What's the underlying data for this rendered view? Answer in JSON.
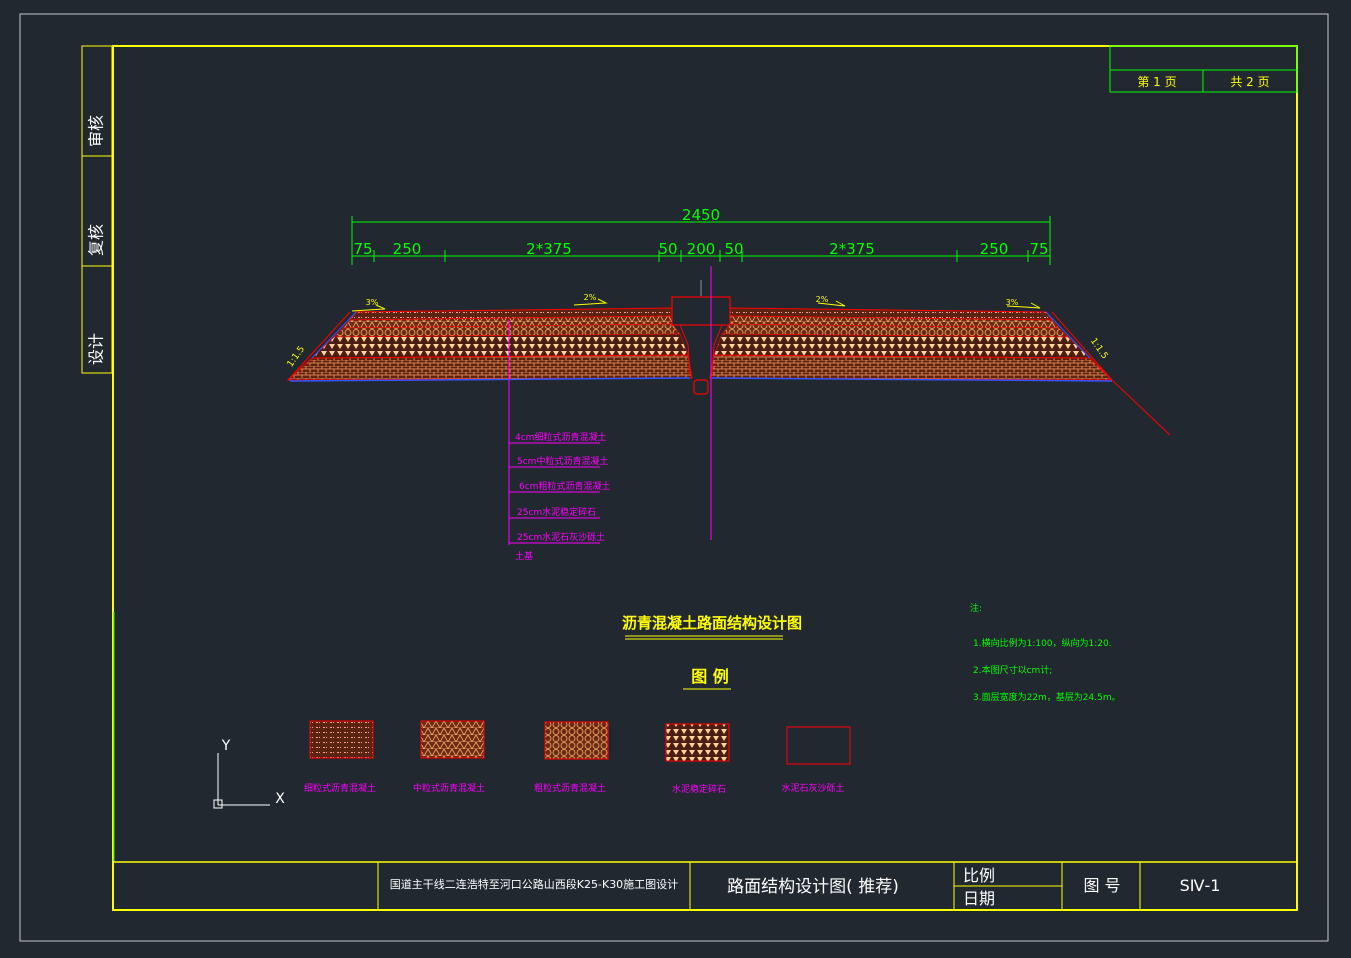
{
  "colors": {
    "background": "#212830",
    "frame": "#ffff00",
    "outer_frame": "#c8c8c8",
    "dimension": "#00ff00",
    "pavement_outline": "#ff0000",
    "pavement_fill": "#7a3418",
    "annotation": "#ff00ff",
    "notes": "#00ff00",
    "text": "#ffffff",
    "base_line": "#3355ff"
  },
  "sidebar": {
    "review": "审核",
    "recheck": "复核",
    "design": "设计"
  },
  "page_box": {
    "page": "第 1 页",
    "total": "共 2 页"
  },
  "dimensions": {
    "total": "2450",
    "segments": [
      "75",
      "250",
      "2*375",
      "50",
      "200",
      "50",
      "2*375",
      "250",
      "75"
    ]
  },
  "slopes": {
    "crossfall": [
      "3%",
      "2%",
      "2%",
      "3%"
    ],
    "side_left": "1:1.5",
    "side_right": "1:1.5"
  },
  "layer_labels": [
    "4cm细粒式沥青混凝土",
    "5cm中粒式沥青混凝土",
    "6cm粗粒式沥青混凝土",
    "25cm水泥稳定碎石",
    "25cm水泥石灰沙砾土",
    "土基"
  ],
  "drawing_title": "沥青混凝土路面结构设计图",
  "legend_title": "图  例",
  "legend_items": [
    "细粒式沥青混凝土",
    "中粒式沥青混凝土",
    "粗粒式沥青混凝土",
    "水泥稳定碎石",
    "水泥石灰沙砾土"
  ],
  "notes": {
    "title": "注:",
    "items": [
      "1.横向比例为1:100，纵向为1:20.",
      "2.本图尺寸以cm计;",
      "3.面层宽度为22m，基层为24.5m。"
    ]
  },
  "ucs": {
    "y": "Y",
    "x": "X"
  },
  "title_block": {
    "project": "国道主干线二连浩特至河口公路山西段K25-K30施工图设计",
    "drawing_name": "路面结构设计图( 推荐)",
    "scale_label": "比例",
    "date_label": "日期",
    "drawing_no_label": "图  号",
    "drawing_no": "SⅣ-1"
  }
}
